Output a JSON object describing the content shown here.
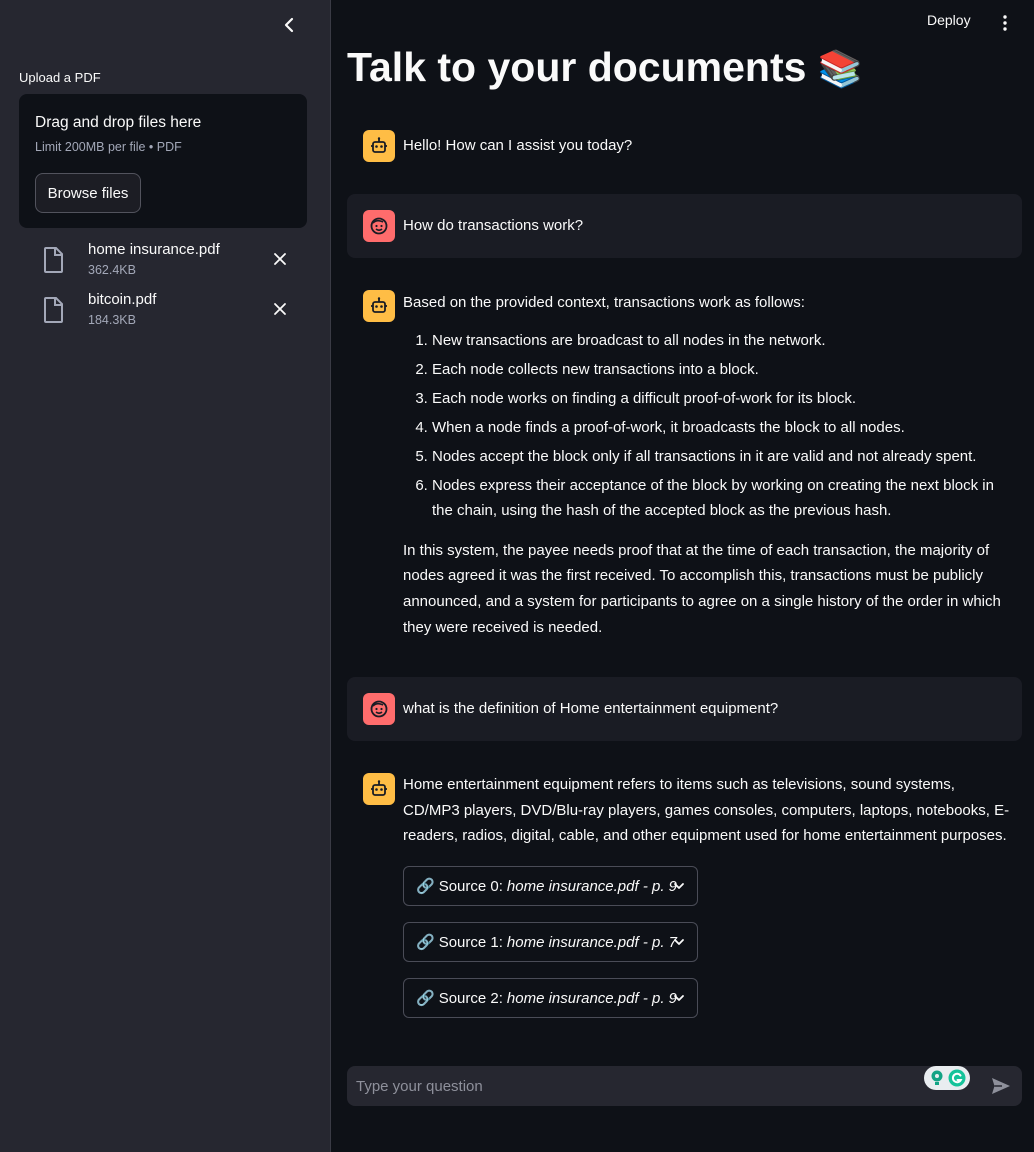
{
  "sidebar": {
    "collapse_icon": "chevron-left-icon",
    "upload_label": "Upload a PDF",
    "dropzone": {
      "title": "Drag and drop files here",
      "limit": "Limit 200MB per file • PDF",
      "browse_label": "Browse files"
    },
    "files": [
      {
        "name": "home insurance.pdf",
        "size": "362.4KB",
        "icon": "file-icon"
      },
      {
        "name": "bitcoin.pdf",
        "size": "184.3KB",
        "icon": "file-icon"
      }
    ]
  },
  "header": {
    "deploy_label": "Deploy",
    "menu_icon": "vertical-dots-icon"
  },
  "main": {
    "title": "Talk to your documents",
    "title_emoji": "📚",
    "messages": [
      {
        "role": "assistant",
        "text": "Hello! How can I assist you today?"
      },
      {
        "role": "user",
        "text": "How do transactions work?"
      },
      {
        "role": "assistant",
        "intro": "Based on the provided context, transactions work as follows:",
        "steps": [
          "New transactions are broadcast to all nodes in the network.",
          "Each node collects new transactions into a block.",
          "Each node works on finding a difficult proof-of-work for its block.",
          "When a node finds a proof-of-work, it broadcasts the block to all nodes.",
          "Nodes accept the block only if all transactions in it are valid and not already spent.",
          "Nodes express their acceptance of the block by working on creating the next block in the chain, using the hash of the accepted block as the previous hash."
        ],
        "closing": "In this system, the payee needs proof that at the time of each transaction, the majority of nodes agreed it was the first received. To accomplish this, transactions must be publicly announced, and a system for participants to agree on a single history of the order in which they were received is needed."
      },
      {
        "role": "user",
        "text": "what is the definition of Home entertainment equipment?"
      },
      {
        "role": "assistant",
        "text": "Home entertainment equipment refers to items such as televisions, sound systems, CD/MP3 players, DVD/Blu-ray players, games consoles, computers, laptops, notebooks, E-readers, radios, digital, cable, and other equipment used for home entertainment purposes.",
        "sources": [
          {
            "emoji": "🔗",
            "label": "Source 0:",
            "ref": "home insurance.pdf - p. 9"
          },
          {
            "emoji": "🔗",
            "label": "Source 1:",
            "ref": "home insurance.pdf - p. 7"
          },
          {
            "emoji": "🔗",
            "label": "Source 2:",
            "ref": "home insurance.pdf - p. 9"
          }
        ]
      }
    ]
  },
  "chat_input": {
    "placeholder": "Type your question",
    "value": "",
    "send_icon": "send-icon",
    "grammarly_icon": "grammarly-icon"
  },
  "colors": {
    "background": "#0e1117",
    "sidebar": "#262730",
    "assistant_avatar": "#ffbd45",
    "user_avatar": "#ff6c6c"
  }
}
